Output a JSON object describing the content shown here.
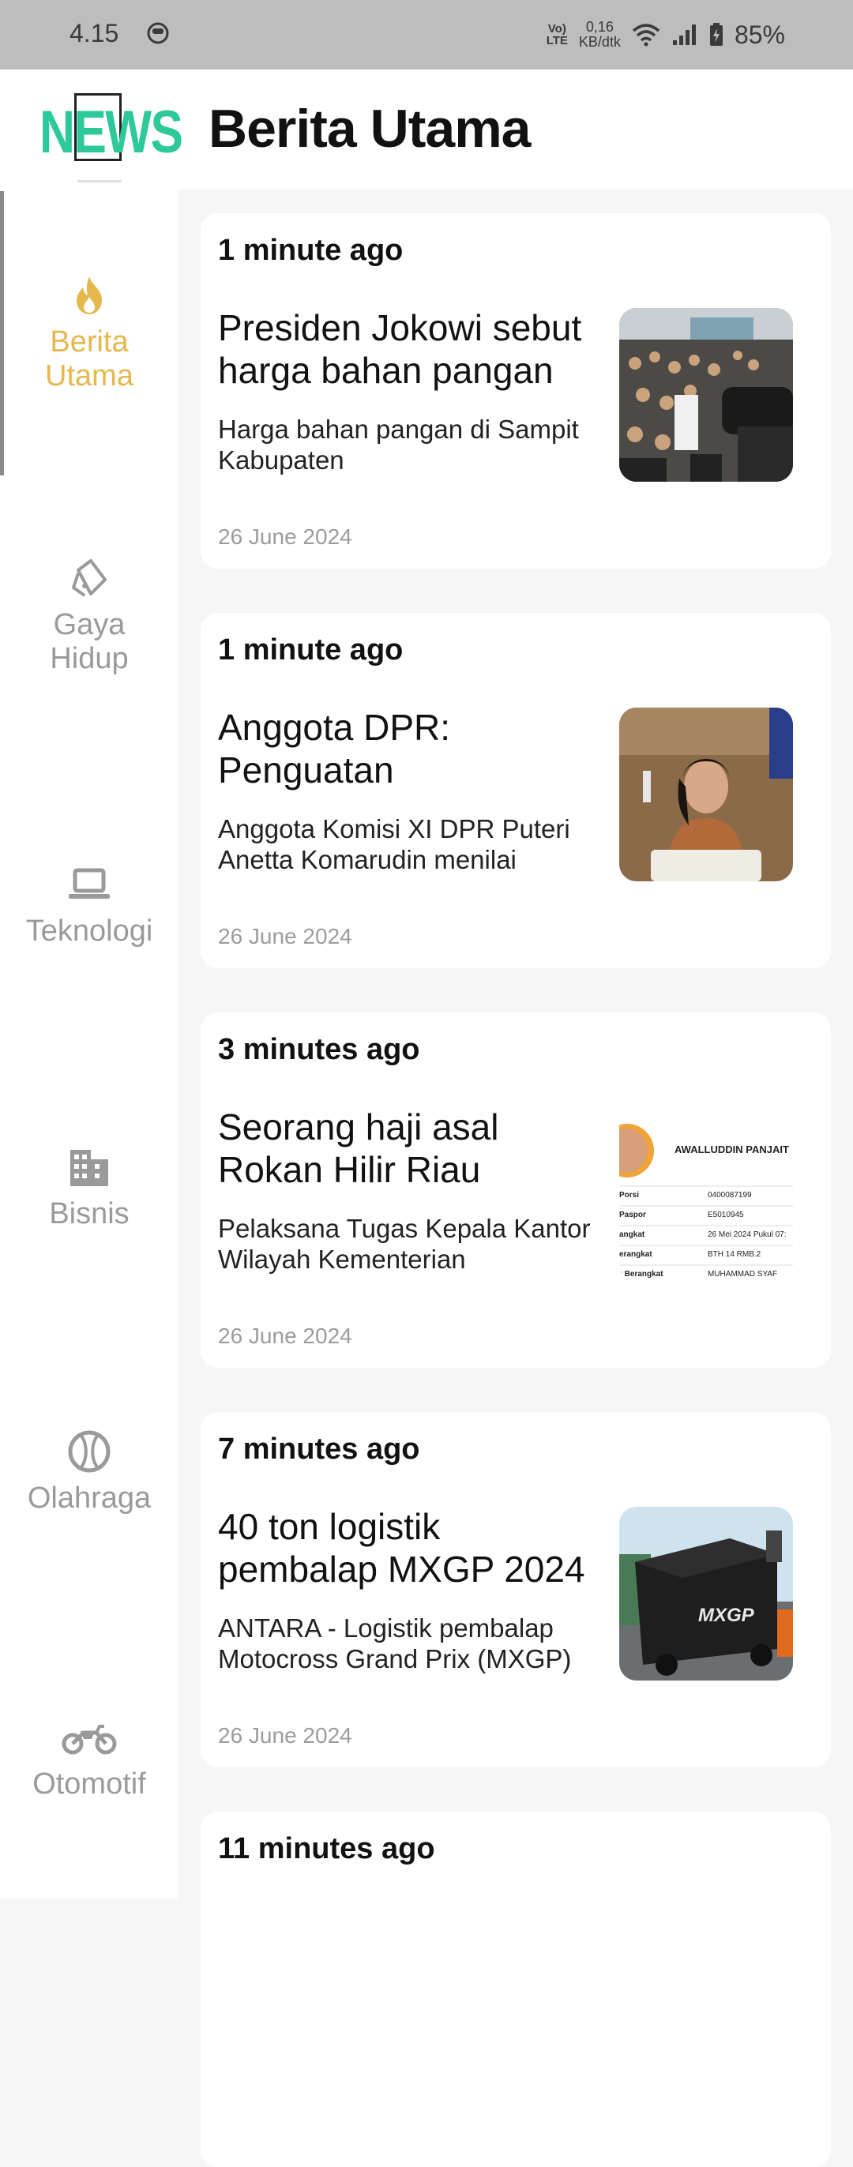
{
  "status_bar": {
    "time": "4.15",
    "volte_top": "Vo)",
    "volte_bottom": "LTE",
    "speed_top": "0,16",
    "speed_bottom": "KB/dtk",
    "battery": "85%"
  },
  "header": {
    "logo_text": "NEWS",
    "title": "Berita Utama"
  },
  "sidebar": {
    "items": [
      {
        "label": "Berita\nUtama",
        "icon": "flame-icon",
        "active": true
      },
      {
        "label": "Gaya\nHidup",
        "icon": "tag-icon",
        "active": false
      },
      {
        "label": "Teknologi",
        "icon": "laptop-icon",
        "active": false
      },
      {
        "label": "Bisnis",
        "icon": "building-icon",
        "active": false
      },
      {
        "label": "Olahraga",
        "icon": "ball-icon",
        "active": false
      },
      {
        "label": "Otomotif",
        "icon": "motorcycle-icon",
        "active": false
      }
    ]
  },
  "articles": [
    {
      "time_ago": "1 minute ago",
      "headline": "Presiden Jokowi sebut harga bahan pangan",
      "summary": "Harga bahan pangan di Sampit Kabupaten",
      "date": "26 June 2024",
      "image": "crowd-photo"
    },
    {
      "time_ago": "1 minute ago",
      "headline": "Anggota DPR: Penguatan",
      "summary": "Anggota Komisi XI DPR Puteri Anetta Komarudin menilai",
      "date": "26 June 2024",
      "image": "speaker-photo"
    },
    {
      "time_ago": "3 minutes ago",
      "headline": "Seorang haji asal Rokan Hilir Riau",
      "summary": "Pelaksana Tugas Kepala Kantor Wilayah Kementerian",
      "date": "26 June 2024",
      "image": "document-photo",
      "doc": {
        "name": "AWALLUDDIN PANJAIT",
        "rows": [
          {
            "k": "Porsi",
            "v": "0400087199"
          },
          {
            "k": "Paspor",
            "v": "E5010945"
          },
          {
            "k": "angkat",
            "v": "26 Mei 2024 Pukul 07:"
          },
          {
            "k": "erangkat",
            "v": "BTH 14 RMB.2"
          },
          {
            "k": "r Berangkat",
            "v": "MUHAMMAD SYAF"
          }
        ]
      }
    },
    {
      "time_ago": "7 minutes ago",
      "headline": "40 ton logistik pembalap MXGP 2024",
      "summary": "ANTARA - Logistik pembalap Motocross Grand Prix (MXGP)",
      "date": "26 June 2024",
      "image": "logistics-photo",
      "crate_label": "MXGP"
    },
    {
      "time_ago": "11 minutes ago"
    }
  ],
  "colors": {
    "accent_active": "#e5b84d",
    "inactive": "#9a9a9a",
    "logo": "#2ec99a",
    "status_bar": "#bdbdbd",
    "background": "#f6f6f6"
  }
}
